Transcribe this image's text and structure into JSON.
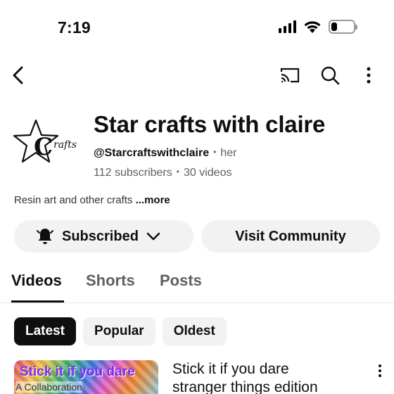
{
  "status_bar": {
    "time": "7:19",
    "battery_level": 0.25,
    "icons": [
      "signal-icon",
      "wifi-icon",
      "battery-icon"
    ]
  },
  "nav": {
    "icons": [
      "back-icon",
      "cast-icon",
      "search-icon",
      "more-vert-icon"
    ]
  },
  "channel": {
    "avatar_letter": "C",
    "avatar_text": "rafts",
    "name": "Star crafts with claire",
    "handle": "@Starcraftswithclaire",
    "pronoun": "her",
    "subscribers": "112 subscribers",
    "videos": "30 videos",
    "separator": "•",
    "description": "Resin art and other crafts",
    "more_label": "...more"
  },
  "actions": {
    "subscribed_label": "Subscribed",
    "community_label": "Visit Community"
  },
  "tabs": [
    {
      "label": "Videos",
      "active": true
    },
    {
      "label": "Shorts",
      "active": false
    },
    {
      "label": "Posts",
      "active": false
    }
  ],
  "chips": [
    {
      "label": "Latest",
      "active": true
    },
    {
      "label": "Popular",
      "active": false
    },
    {
      "label": "Oldest",
      "active": false
    }
  ],
  "videos": [
    {
      "thumb_title": "Stick it if you dare",
      "thumb_sub": "A Collaboration",
      "title_line1": "Stick it if you dare",
      "title_line2": "stranger things edition"
    }
  ],
  "colors": {
    "text_primary": "#0f0f0f",
    "text_secondary": "#606060",
    "chip_bg": "#f2f2f2",
    "chip_active_bg": "#0f0f0f"
  }
}
